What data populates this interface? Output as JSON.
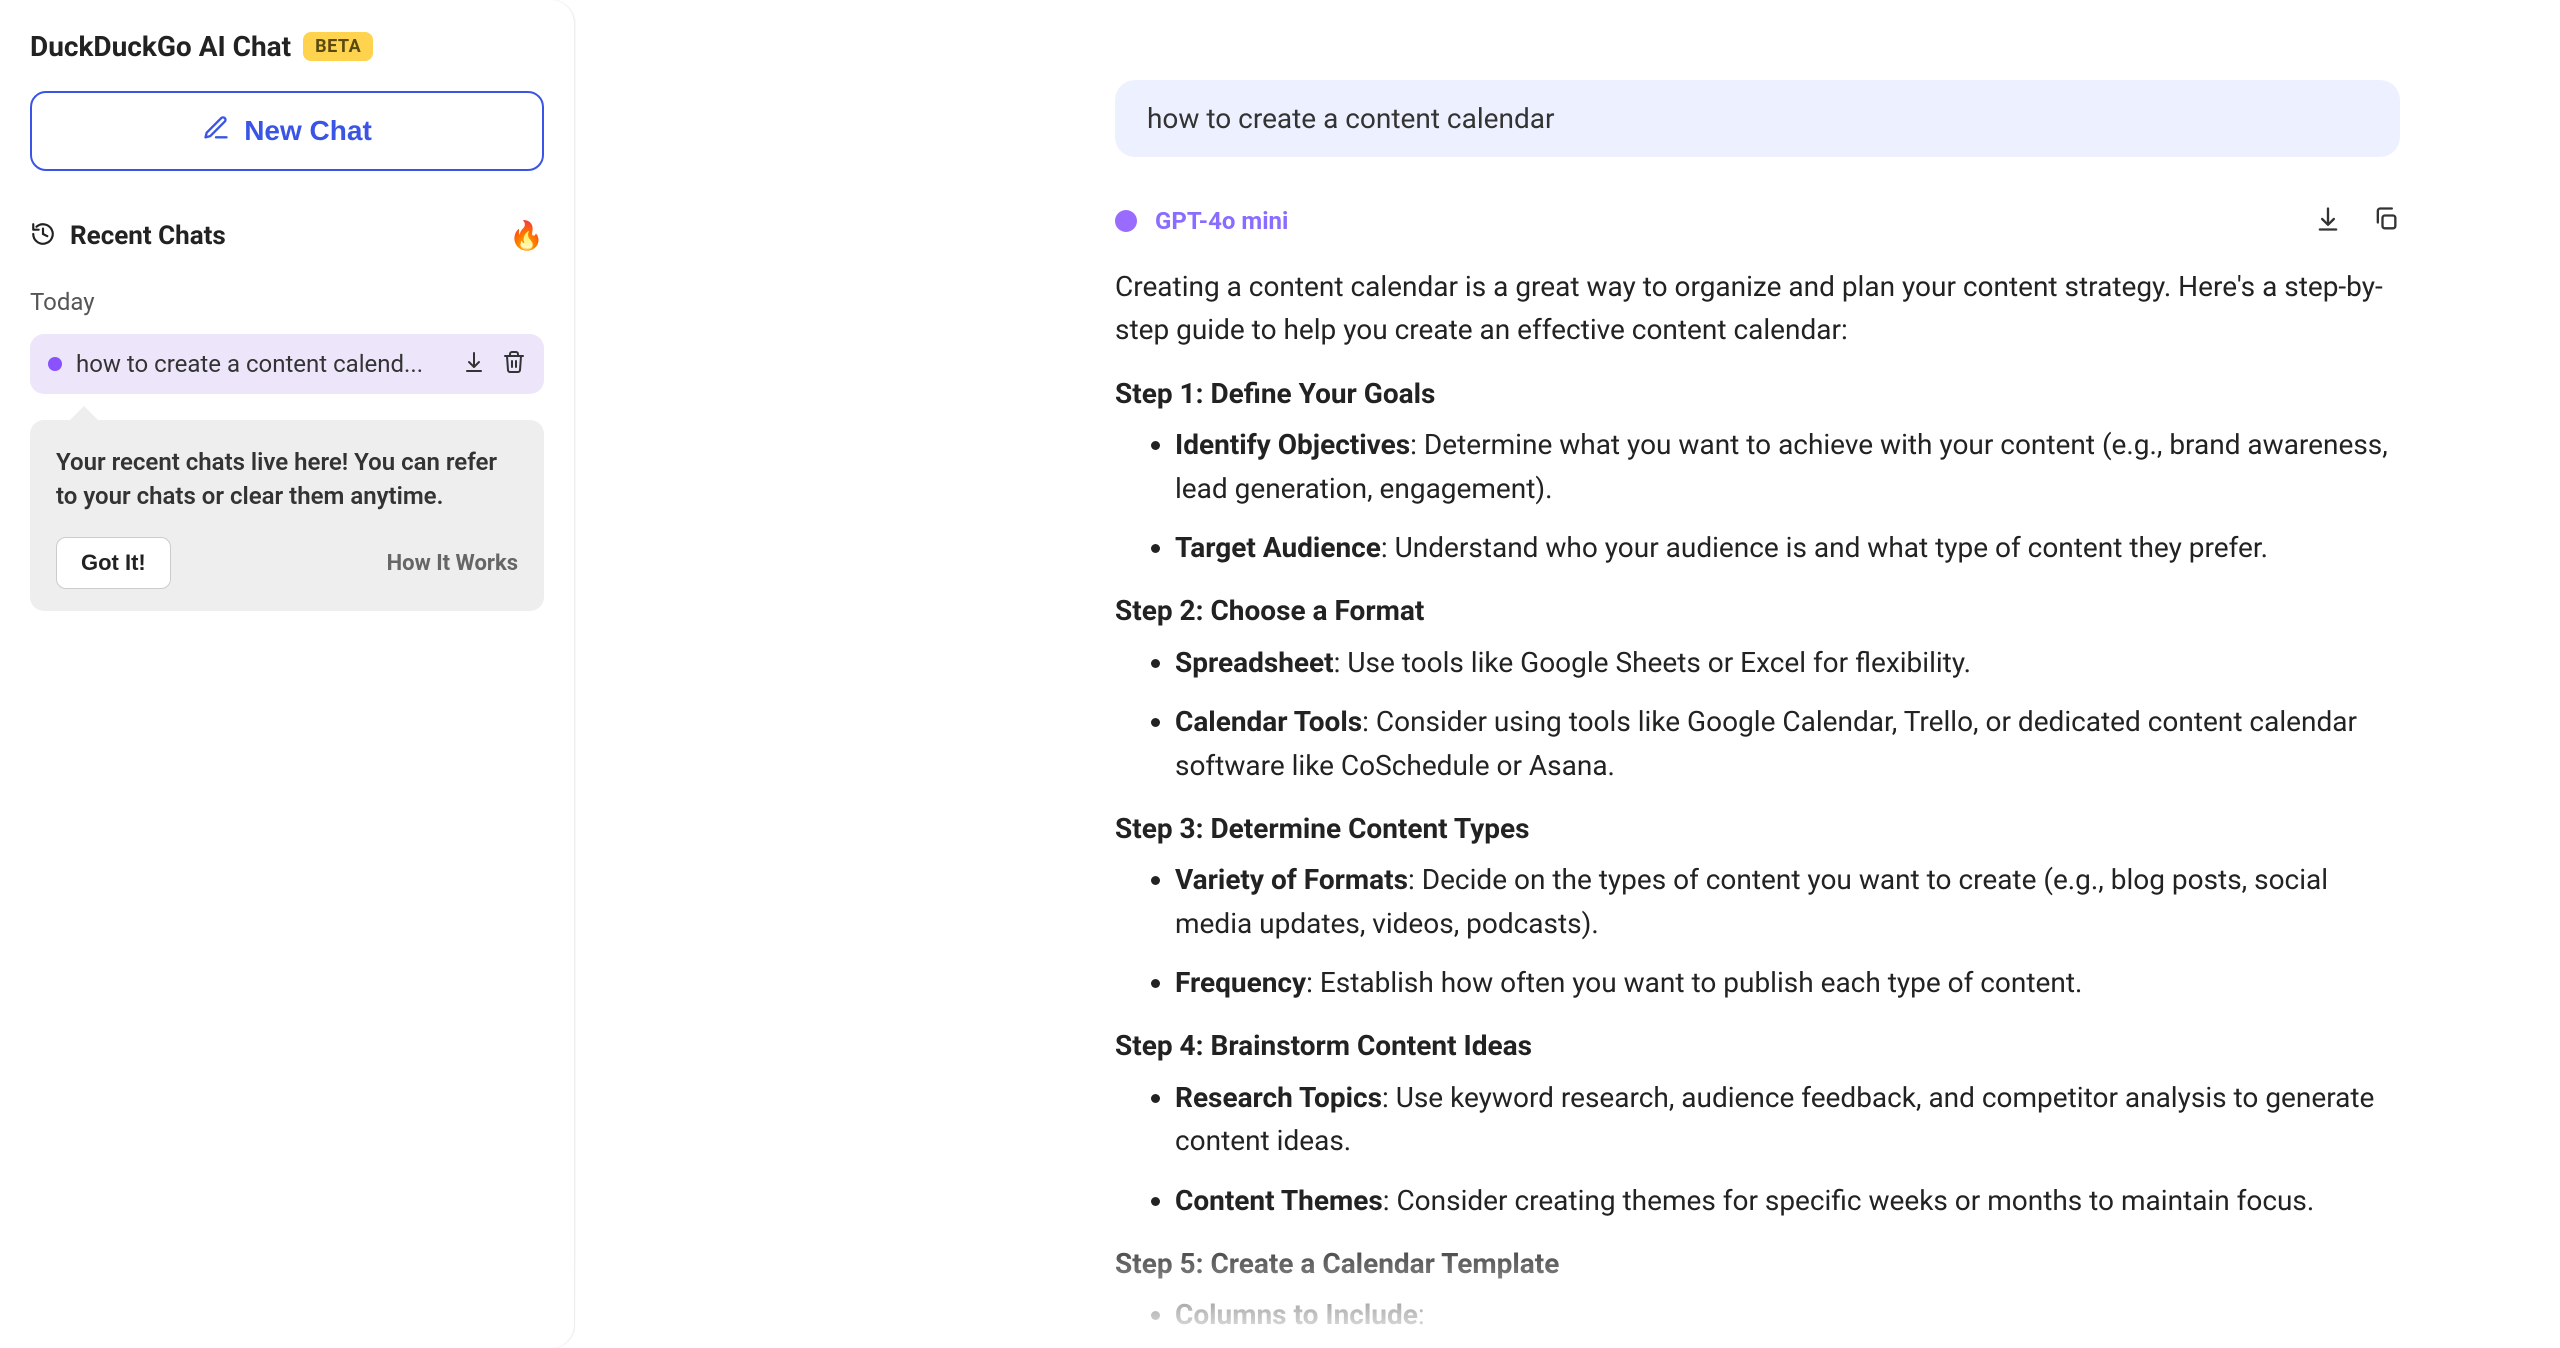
{
  "sidebar": {
    "brand_title": "DuckDuckGo AI Chat",
    "beta_label": "BETA",
    "new_chat_label": "New Chat",
    "recent_title": "Recent Chats",
    "fire_emoji": "🔥",
    "today_label": "Today",
    "chat_item_title": "how to create a content calend...",
    "info_text": "Your recent chats live here! You can refer to your chats or clear them anytime.",
    "got_it_label": "Got It!",
    "how_it_works_label": "How It Works"
  },
  "conversation": {
    "user_message": "how to create a content calendar",
    "model_name": "GPT-4o mini",
    "intro": "Creating a content calendar is a great way to organize and plan your content strategy. Here's a step-by-step guide to help you create an effective content calendar:",
    "steps": [
      {
        "heading": "Step 1: Define Your Goals",
        "items": [
          {
            "bold": "Identify Objectives",
            "rest": ": Determine what you want to achieve with your content (e.g., brand awareness, lead generation, engagement)."
          },
          {
            "bold": "Target Audience",
            "rest": ": Understand who your audience is and what type of content they prefer."
          }
        ]
      },
      {
        "heading": "Step 2: Choose a Format",
        "items": [
          {
            "bold": "Spreadsheet",
            "rest": ": Use tools like Google Sheets or Excel for flexibility."
          },
          {
            "bold": "Calendar Tools",
            "rest": ": Consider using tools like Google Calendar, Trello, or dedicated content calendar software like CoSchedule or Asana."
          }
        ]
      },
      {
        "heading": "Step 3: Determine Content Types",
        "items": [
          {
            "bold": "Variety of Formats",
            "rest": ": Decide on the types of content you want to create (e.g., blog posts, social media updates, videos, podcasts)."
          },
          {
            "bold": "Frequency",
            "rest": ": Establish how often you want to publish each type of content."
          }
        ]
      },
      {
        "heading": "Step 4: Brainstorm Content Ideas",
        "items": [
          {
            "bold": "Research Topics",
            "rest": ": Use keyword research, audience feedback, and competitor analysis to generate content ideas."
          },
          {
            "bold": "Content Themes",
            "rest": ": Consider creating themes for specific weeks or months to maintain focus."
          }
        ]
      },
      {
        "heading": "Step 5: Create a Calendar Template",
        "items": [
          {
            "bold": "Columns to Include",
            "rest": ":"
          }
        ]
      }
    ]
  }
}
